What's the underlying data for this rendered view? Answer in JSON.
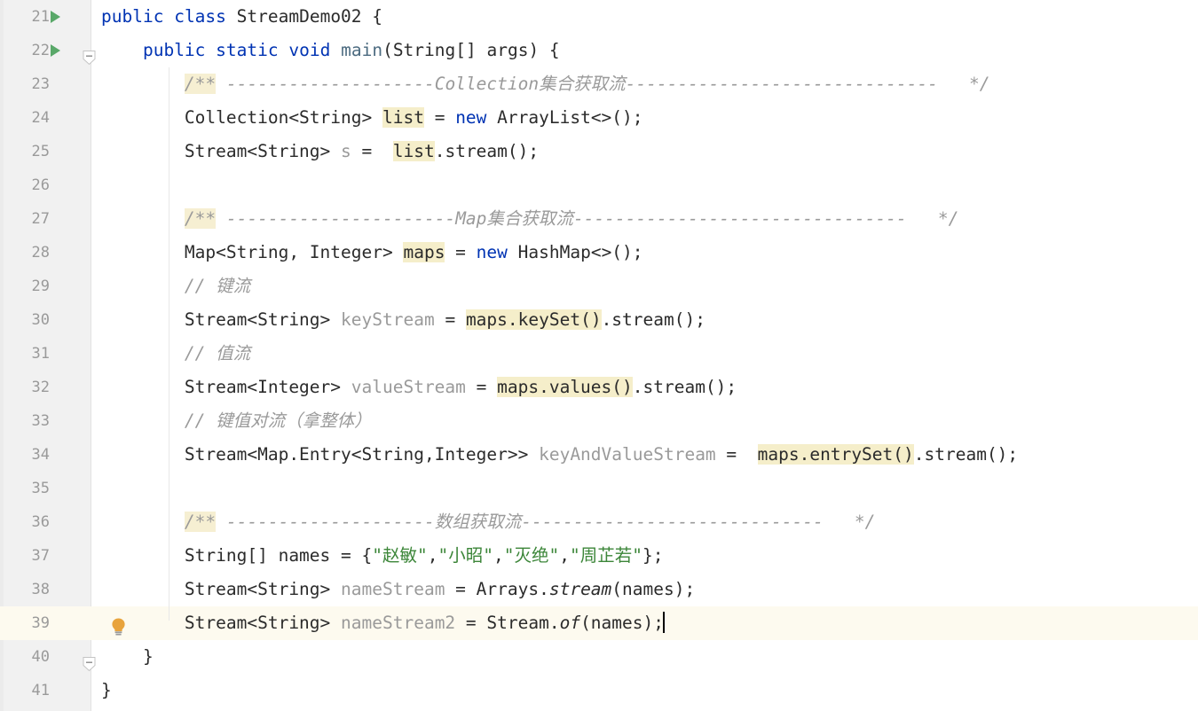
{
  "editor": {
    "app": "IntelliJ IDEA Java Editor",
    "language": "java",
    "first_line_number": 21,
    "current_line": 39,
    "caret_line": 39,
    "colors": {
      "background": "#ffffff",
      "gutter_background": "#f1f1f1",
      "line_number": "#9a9a9a",
      "keyword": "#0033b3",
      "string": "#3c8639",
      "comment": "#9a9a9a",
      "method_declaration": "#4c6b80",
      "unused_identifier": "#9a9a9a",
      "identifier_occurrence_highlight": "#f5eeca",
      "current_line_highlight": "#fdfaef",
      "run_marker_green": "#59a869",
      "intention_bulb_amber": "#e8a33d"
    },
    "icons": {
      "run": "run-triangle-icon",
      "fold": "fold-shield-icon",
      "intention": "intention-bulb-icon"
    },
    "lines": [
      {
        "no": "21",
        "run": true,
        "fold": false,
        "bulb": false,
        "current": false,
        "tokens": [
          {
            "t": "public",
            "c": "kw"
          },
          {
            "t": " ",
            "c": "punct"
          },
          {
            "t": "class",
            "c": "kw"
          },
          {
            "t": " ",
            "c": "punct"
          },
          {
            "t": "StreamDemo02",
            "c": "type"
          },
          {
            "t": " {",
            "c": "punct"
          }
        ]
      },
      {
        "no": "22",
        "run": true,
        "fold": true,
        "bulb": false,
        "current": false,
        "tokens": [
          {
            "t": "    ",
            "c": "punct"
          },
          {
            "t": "public",
            "c": "kw"
          },
          {
            "t": " ",
            "c": "punct"
          },
          {
            "t": "static",
            "c": "kw"
          },
          {
            "t": " ",
            "c": "punct"
          },
          {
            "t": "void",
            "c": "kw"
          },
          {
            "t": " ",
            "c": "punct"
          },
          {
            "t": "main",
            "c": "method"
          },
          {
            "t": "(",
            "c": "punct"
          },
          {
            "t": "String[] args",
            "c": "type"
          },
          {
            "t": ") {",
            "c": "punct"
          }
        ]
      },
      {
        "no": "23",
        "run": false,
        "fold": false,
        "bulb": false,
        "current": false,
        "tokens": [
          {
            "t": "        ",
            "c": "punct"
          },
          {
            "t": "/**",
            "c": "docmark"
          },
          {
            "t": " --------------------",
            "c": "cmt"
          },
          {
            "t": "Collection",
            "c": "cmt"
          },
          {
            "t": "集合获取流",
            "c": "cmt"
          },
          {
            "t": "------------------------------",
            "c": "cmt"
          },
          {
            "t": "   */",
            "c": "cmt"
          }
        ]
      },
      {
        "no": "24",
        "run": false,
        "fold": false,
        "bulb": false,
        "current": false,
        "tokens": [
          {
            "t": "        ",
            "c": "punct"
          },
          {
            "t": "Collection<String> ",
            "c": "type"
          },
          {
            "t": "list",
            "c": "hl"
          },
          {
            "t": " = ",
            "c": "punct"
          },
          {
            "t": "new",
            "c": "kw"
          },
          {
            "t": " ArrayList<>();",
            "c": "type"
          }
        ]
      },
      {
        "no": "25",
        "run": false,
        "fold": false,
        "bulb": false,
        "current": false,
        "tokens": [
          {
            "t": "        ",
            "c": "punct"
          },
          {
            "t": "Stream<String> ",
            "c": "type"
          },
          {
            "t": "s",
            "c": "grayid"
          },
          {
            "t": " =  ",
            "c": "punct"
          },
          {
            "t": "list",
            "c": "hl"
          },
          {
            "t": ".stream();",
            "c": "punct"
          }
        ]
      },
      {
        "no": "26",
        "run": false,
        "fold": false,
        "bulb": false,
        "current": false,
        "tokens": []
      },
      {
        "no": "27",
        "run": false,
        "fold": false,
        "bulb": false,
        "current": false,
        "tokens": [
          {
            "t": "        ",
            "c": "punct"
          },
          {
            "t": "/**",
            "c": "docmark"
          },
          {
            "t": " ----------------------",
            "c": "cmt"
          },
          {
            "t": "Map",
            "c": "cmt"
          },
          {
            "t": "集合获取流",
            "c": "cmt"
          },
          {
            "t": "--------------------------------",
            "c": "cmt"
          },
          {
            "t": "   */",
            "c": "cmt"
          }
        ]
      },
      {
        "no": "28",
        "run": false,
        "fold": false,
        "bulb": false,
        "current": false,
        "tokens": [
          {
            "t": "        ",
            "c": "punct"
          },
          {
            "t": "Map<String, Integer> ",
            "c": "type"
          },
          {
            "t": "maps",
            "c": "hl"
          },
          {
            "t": " = ",
            "c": "punct"
          },
          {
            "t": "new",
            "c": "kw"
          },
          {
            "t": " HashMap<>();",
            "c": "type"
          }
        ]
      },
      {
        "no": "29",
        "run": false,
        "fold": false,
        "bulb": false,
        "current": false,
        "tokens": [
          {
            "t": "        ",
            "c": "punct"
          },
          {
            "t": "// 键流",
            "c": "cmt"
          }
        ]
      },
      {
        "no": "30",
        "run": false,
        "fold": false,
        "bulb": false,
        "current": false,
        "tokens": [
          {
            "t": "        ",
            "c": "punct"
          },
          {
            "t": "Stream<String> ",
            "c": "type"
          },
          {
            "t": "keyStream",
            "c": "grayid"
          },
          {
            "t": " = ",
            "c": "punct"
          },
          {
            "t": "maps.keySet()",
            "c": "hl"
          },
          {
            "t": ".stream();",
            "c": "punct"
          }
        ]
      },
      {
        "no": "31",
        "run": false,
        "fold": false,
        "bulb": false,
        "current": false,
        "tokens": [
          {
            "t": "        ",
            "c": "punct"
          },
          {
            "t": "// 值流",
            "c": "cmt"
          }
        ]
      },
      {
        "no": "32",
        "run": false,
        "fold": false,
        "bulb": false,
        "current": false,
        "tokens": [
          {
            "t": "        ",
            "c": "punct"
          },
          {
            "t": "Stream<Integer> ",
            "c": "type"
          },
          {
            "t": "valueStream",
            "c": "grayid"
          },
          {
            "t": " = ",
            "c": "punct"
          },
          {
            "t": "maps.values()",
            "c": "hl"
          },
          {
            "t": ".stream();",
            "c": "punct"
          }
        ]
      },
      {
        "no": "33",
        "run": false,
        "fold": false,
        "bulb": false,
        "current": false,
        "tokens": [
          {
            "t": "        ",
            "c": "punct"
          },
          {
            "t": "// 键值对流（拿整体）",
            "c": "cmt"
          }
        ]
      },
      {
        "no": "34",
        "run": false,
        "fold": false,
        "bulb": false,
        "current": false,
        "tokens": [
          {
            "t": "        ",
            "c": "punct"
          },
          {
            "t": "Stream<Map.Entry<String,Integer>> ",
            "c": "type"
          },
          {
            "t": "keyAndValueStream",
            "c": "grayid"
          },
          {
            "t": " =  ",
            "c": "punct"
          },
          {
            "t": "maps.entrySet()",
            "c": "hl"
          },
          {
            "t": ".stream();",
            "c": "punct"
          }
        ]
      },
      {
        "no": "35",
        "run": false,
        "fold": false,
        "bulb": false,
        "current": false,
        "tokens": []
      },
      {
        "no": "36",
        "run": false,
        "fold": false,
        "bulb": false,
        "current": false,
        "tokens": [
          {
            "t": "        ",
            "c": "punct"
          },
          {
            "t": "/**",
            "c": "docmark"
          },
          {
            "t": " --------------------",
            "c": "cmt"
          },
          {
            "t": "数组获取流",
            "c": "cmt"
          },
          {
            "t": "-----------------------------",
            "c": "cmt"
          },
          {
            "t": "   */",
            "c": "cmt"
          }
        ]
      },
      {
        "no": "37",
        "run": false,
        "fold": false,
        "bulb": false,
        "current": false,
        "tokens": [
          {
            "t": "        ",
            "c": "punct"
          },
          {
            "t": "String[] names",
            "c": "type"
          },
          {
            "t": " = {",
            "c": "punct"
          },
          {
            "t": "\"赵敏\"",
            "c": "str"
          },
          {
            "t": ",",
            "c": "punct"
          },
          {
            "t": "\"小昭\"",
            "c": "str"
          },
          {
            "t": ",",
            "c": "punct"
          },
          {
            "t": "\"灭绝\"",
            "c": "str"
          },
          {
            "t": ",",
            "c": "punct"
          },
          {
            "t": "\"周芷若\"",
            "c": "str"
          },
          {
            "t": "};",
            "c": "punct"
          }
        ]
      },
      {
        "no": "38",
        "run": false,
        "fold": false,
        "bulb": false,
        "current": false,
        "tokens": [
          {
            "t": "        ",
            "c": "punct"
          },
          {
            "t": "Stream<String> ",
            "c": "type"
          },
          {
            "t": "nameStream",
            "c": "grayid"
          },
          {
            "t": " = Arrays.",
            "c": "punct"
          },
          {
            "t": "stream",
            "c": "stat"
          },
          {
            "t": "(names);",
            "c": "punct"
          }
        ]
      },
      {
        "no": "39",
        "run": false,
        "fold": false,
        "bulb": true,
        "current": true,
        "caret": true,
        "tokens": [
          {
            "t": "        ",
            "c": "punct"
          },
          {
            "t": "Stream<String> ",
            "c": "type"
          },
          {
            "t": "nameStream2",
            "c": "grayid"
          },
          {
            "t": " = Stream.",
            "c": "punct"
          },
          {
            "t": "of",
            "c": "stat"
          },
          {
            "t": "(names);",
            "c": "punct"
          }
        ]
      },
      {
        "no": "40",
        "run": false,
        "fold": true,
        "bulb": false,
        "current": false,
        "tokens": [
          {
            "t": "    }",
            "c": "punct"
          }
        ]
      },
      {
        "no": "41",
        "run": false,
        "fold": false,
        "bulb": false,
        "current": false,
        "tokens": [
          {
            "t": "}",
            "c": "punct"
          }
        ]
      }
    ]
  }
}
